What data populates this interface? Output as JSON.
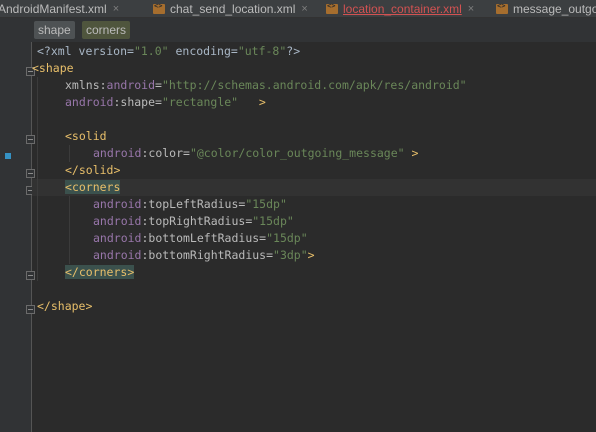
{
  "tabs": [
    {
      "label": "AndroidManifest.xml",
      "close": "×",
      "error": false
    },
    {
      "label": "chat_send_location.xml",
      "close": "×",
      "error": false
    },
    {
      "label": "location_container.xml",
      "close": "×",
      "error": true
    },
    {
      "label": "message_outgoing",
      "close": "",
      "error": false
    }
  ],
  "breadcrumb": [
    "shape",
    "corners"
  ],
  "code": {
    "l1_open": "<?xml version=",
    "l1_v1": "\"1.0\"",
    "l1_mid": " encoding=",
    "l1_v2": "\"utf-8\"",
    "l1_close": "?>",
    "l2_tag": "<shape",
    "l3_attr": "xmlns:",
    "l3_ns": "android",
    "l3_eq": "=",
    "l3_val": "\"http://schemas.android.com/apk/res/android\"",
    "l4_ns": "android",
    "l4_attr": ":shape=",
    "l4_val": "\"rectangle\"",
    "l4_end": "   >",
    "l6_tag": "<solid",
    "l7_ns": "android",
    "l7_attr": ":color=",
    "l7_val": "\"@color/color_outgoing_message\"",
    "l7_end": " >",
    "l8_tag": "</solid>",
    "l9_tag_open": "<",
    "l9_tag_name": "corners",
    "l10_ns": "android",
    "l10_attr": ":topLeftRadius=",
    "l10_val": "\"15dp\"",
    "l11_ns": "android",
    "l11_attr": ":topRightRadius=",
    "l11_val": "\"15dp\"",
    "l12_ns": "android",
    "l12_attr": ":bottomLeftRadius=",
    "l12_val": "\"15dp\"",
    "l13_ns": "android",
    "l13_attr": ":bottomRightRadius=",
    "l13_val": "\"3dp\"",
    "l13_end": ">",
    "l14_open": "</",
    "l14_name": "corners",
    "l14_close": ">",
    "l16_tag": "</shape>"
  },
  "colors": {
    "tag": "#e8bf6a",
    "namespace": "#9876aa",
    "string": "#6a8759",
    "gutter_marker": "#3592c4",
    "error_tab": "#d25252"
  },
  "icons": [
    "xml-file-icon",
    "close-icon",
    "fold-marker-icon",
    "change-marker-icon"
  ]
}
